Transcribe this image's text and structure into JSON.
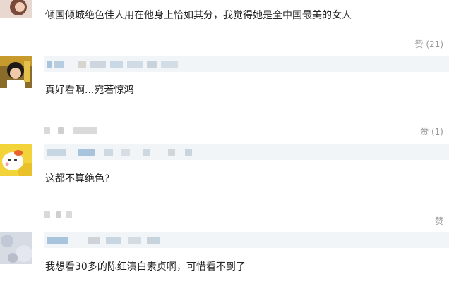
{
  "comments": [
    {
      "text": "倾国倾城绝色佳人用在他身上恰如其分，我觉得她是全中国最美的女人",
      "likes_label": "赞 (21)"
    },
    {
      "text": "真好看啊...宛若惊鸿",
      "likes_label": "赞 (1)"
    },
    {
      "text": "这都不算绝色?",
      "likes_label": "赞"
    },
    {
      "text": "我想看30多的陈红演白素贞啊，可惜看不到了",
      "likes_label": ""
    }
  ],
  "colors": {
    "like_text": "#999999",
    "name_bar_bg": "#f2f5f7",
    "blur_blue": "#a8c4dc",
    "blur_gray": "#d9d9d9",
    "avatar_yellow": "#f3d33a"
  },
  "icons": [
    "user-avatar-icon"
  ]
}
